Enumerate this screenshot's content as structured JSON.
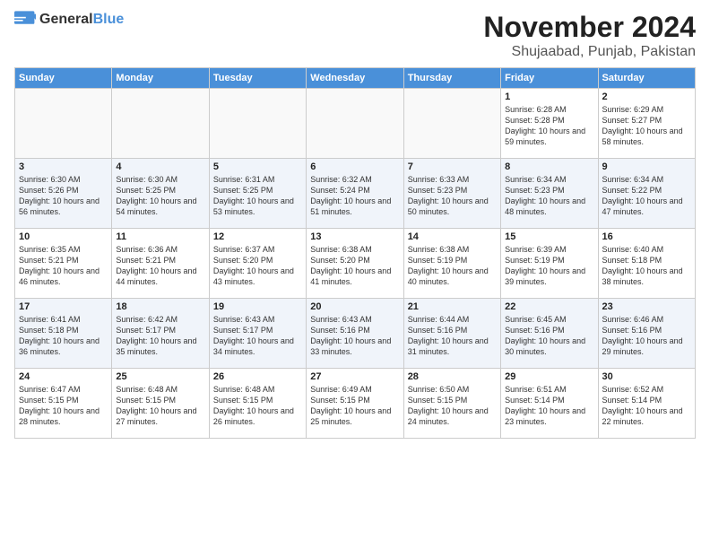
{
  "logo": {
    "general": "General",
    "blue": "Blue"
  },
  "header": {
    "month": "November 2024",
    "location": "Shujaabad, Punjab, Pakistan"
  },
  "weekdays": [
    "Sunday",
    "Monday",
    "Tuesday",
    "Wednesday",
    "Thursday",
    "Friday",
    "Saturday"
  ],
  "weeks": [
    [
      {
        "day": "",
        "info": ""
      },
      {
        "day": "",
        "info": ""
      },
      {
        "day": "",
        "info": ""
      },
      {
        "day": "",
        "info": ""
      },
      {
        "day": "",
        "info": ""
      },
      {
        "day": "1",
        "info": "Sunrise: 6:28 AM\nSunset: 5:28 PM\nDaylight: 10 hours and 59 minutes."
      },
      {
        "day": "2",
        "info": "Sunrise: 6:29 AM\nSunset: 5:27 PM\nDaylight: 10 hours and 58 minutes."
      }
    ],
    [
      {
        "day": "3",
        "info": "Sunrise: 6:30 AM\nSunset: 5:26 PM\nDaylight: 10 hours and 56 minutes."
      },
      {
        "day": "4",
        "info": "Sunrise: 6:30 AM\nSunset: 5:25 PM\nDaylight: 10 hours and 54 minutes."
      },
      {
        "day": "5",
        "info": "Sunrise: 6:31 AM\nSunset: 5:25 PM\nDaylight: 10 hours and 53 minutes."
      },
      {
        "day": "6",
        "info": "Sunrise: 6:32 AM\nSunset: 5:24 PM\nDaylight: 10 hours and 51 minutes."
      },
      {
        "day": "7",
        "info": "Sunrise: 6:33 AM\nSunset: 5:23 PM\nDaylight: 10 hours and 50 minutes."
      },
      {
        "day": "8",
        "info": "Sunrise: 6:34 AM\nSunset: 5:23 PM\nDaylight: 10 hours and 48 minutes."
      },
      {
        "day": "9",
        "info": "Sunrise: 6:34 AM\nSunset: 5:22 PM\nDaylight: 10 hours and 47 minutes."
      }
    ],
    [
      {
        "day": "10",
        "info": "Sunrise: 6:35 AM\nSunset: 5:21 PM\nDaylight: 10 hours and 46 minutes."
      },
      {
        "day": "11",
        "info": "Sunrise: 6:36 AM\nSunset: 5:21 PM\nDaylight: 10 hours and 44 minutes."
      },
      {
        "day": "12",
        "info": "Sunrise: 6:37 AM\nSunset: 5:20 PM\nDaylight: 10 hours and 43 minutes."
      },
      {
        "day": "13",
        "info": "Sunrise: 6:38 AM\nSunset: 5:20 PM\nDaylight: 10 hours and 41 minutes."
      },
      {
        "day": "14",
        "info": "Sunrise: 6:38 AM\nSunset: 5:19 PM\nDaylight: 10 hours and 40 minutes."
      },
      {
        "day": "15",
        "info": "Sunrise: 6:39 AM\nSunset: 5:19 PM\nDaylight: 10 hours and 39 minutes."
      },
      {
        "day": "16",
        "info": "Sunrise: 6:40 AM\nSunset: 5:18 PM\nDaylight: 10 hours and 38 minutes."
      }
    ],
    [
      {
        "day": "17",
        "info": "Sunrise: 6:41 AM\nSunset: 5:18 PM\nDaylight: 10 hours and 36 minutes."
      },
      {
        "day": "18",
        "info": "Sunrise: 6:42 AM\nSunset: 5:17 PM\nDaylight: 10 hours and 35 minutes."
      },
      {
        "day": "19",
        "info": "Sunrise: 6:43 AM\nSunset: 5:17 PM\nDaylight: 10 hours and 34 minutes."
      },
      {
        "day": "20",
        "info": "Sunrise: 6:43 AM\nSunset: 5:16 PM\nDaylight: 10 hours and 33 minutes."
      },
      {
        "day": "21",
        "info": "Sunrise: 6:44 AM\nSunset: 5:16 PM\nDaylight: 10 hours and 31 minutes."
      },
      {
        "day": "22",
        "info": "Sunrise: 6:45 AM\nSunset: 5:16 PM\nDaylight: 10 hours and 30 minutes."
      },
      {
        "day": "23",
        "info": "Sunrise: 6:46 AM\nSunset: 5:16 PM\nDaylight: 10 hours and 29 minutes."
      }
    ],
    [
      {
        "day": "24",
        "info": "Sunrise: 6:47 AM\nSunset: 5:15 PM\nDaylight: 10 hours and 28 minutes."
      },
      {
        "day": "25",
        "info": "Sunrise: 6:48 AM\nSunset: 5:15 PM\nDaylight: 10 hours and 27 minutes."
      },
      {
        "day": "26",
        "info": "Sunrise: 6:48 AM\nSunset: 5:15 PM\nDaylight: 10 hours and 26 minutes."
      },
      {
        "day": "27",
        "info": "Sunrise: 6:49 AM\nSunset: 5:15 PM\nDaylight: 10 hours and 25 minutes."
      },
      {
        "day": "28",
        "info": "Sunrise: 6:50 AM\nSunset: 5:15 PM\nDaylight: 10 hours and 24 minutes."
      },
      {
        "day": "29",
        "info": "Sunrise: 6:51 AM\nSunset: 5:14 PM\nDaylight: 10 hours and 23 minutes."
      },
      {
        "day": "30",
        "info": "Sunrise: 6:52 AM\nSunset: 5:14 PM\nDaylight: 10 hours and 22 minutes."
      }
    ]
  ]
}
